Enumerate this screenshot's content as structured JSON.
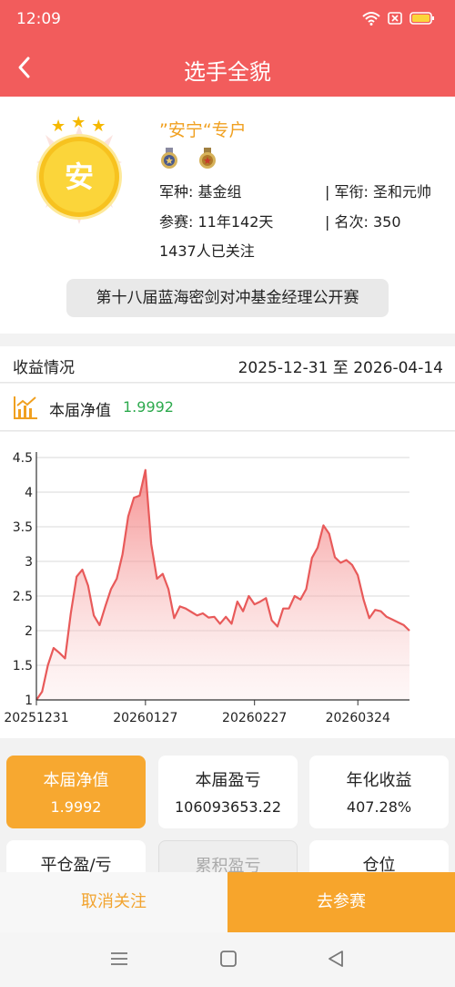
{
  "status_bar": {
    "time": "12:09"
  },
  "nav": {
    "title": "选手全貌"
  },
  "profile": {
    "avatar_char": "安",
    "name": "”安宁“专户",
    "arm_label": "军种: 基金组",
    "rank_label": "| 军衔: 圣和元帅",
    "tenure_label": "参赛: 11年142天",
    "position_label": "| 名次: 350",
    "followers": "1437人已关注",
    "contest": "第十八届蓝海密剑对冲基金经理公开赛"
  },
  "earnings": {
    "title": "收益情况",
    "range": "2025-12-31 至 2026-04-14",
    "nav_label": "本届净值",
    "nav_value": "1.9992"
  },
  "colors": {
    "header": "#f25c5c",
    "accent": "#f7a52c",
    "line": "#e85a5a",
    "positive": "#2eaa4e"
  },
  "chart_data": {
    "type": "area",
    "x_tick_labels": [
      "20251231",
      "20260127",
      "20260227",
      "20260324"
    ],
    "y_ticks": [
      1,
      1.5,
      2,
      2.5,
      3,
      3.5,
      4,
      4.5
    ],
    "ylim": [
      1,
      4.5
    ],
    "grid": true,
    "series": [
      {
        "values": [
          1.0,
          1.12,
          1.5,
          1.75,
          1.68,
          1.6,
          2.25,
          2.78,
          2.88,
          2.65,
          2.22,
          2.08,
          2.35,
          2.6,
          2.75,
          3.1,
          3.65,
          3.92,
          3.95,
          4.32,
          3.25,
          2.75,
          2.82,
          2.6,
          2.18,
          2.35,
          2.32,
          2.27,
          2.22,
          2.25,
          2.19,
          2.2,
          2.1,
          2.2,
          2.1,
          2.42,
          2.28,
          2.5,
          2.38,
          2.42,
          2.47,
          2.15,
          2.06,
          2.32,
          2.32,
          2.5,
          2.45,
          2.6,
          3.05,
          3.2,
          3.52,
          3.4,
          3.06,
          2.98,
          3.02,
          2.95,
          2.8,
          2.45,
          2.18,
          2.3,
          2.28,
          2.2,
          2.16,
          2.12,
          2.08,
          2.0
        ]
      }
    ]
  },
  "cards": [
    {
      "label": "本届净值",
      "value": "1.9992"
    },
    {
      "label": "本届盈亏",
      "value": "106093653.22"
    },
    {
      "label": "年化收益",
      "value": "407.28%"
    },
    {
      "label": "平仓盈/亏",
      "value": ""
    },
    {
      "label": "累积盈亏",
      "value": ""
    },
    {
      "label": "仓位",
      "value": ""
    }
  ],
  "actions": {
    "unfollow": "取消关注",
    "join": "去参赛"
  },
  "icons": {
    "back": "chevron-left-icon",
    "wifi": "wifi-icon",
    "sim": "sim-icon",
    "battery": "battery-icon",
    "chart": "bar-chart-icon",
    "menu": "menu-icon",
    "home": "home-icon",
    "back_sys": "triangle-back-icon"
  }
}
